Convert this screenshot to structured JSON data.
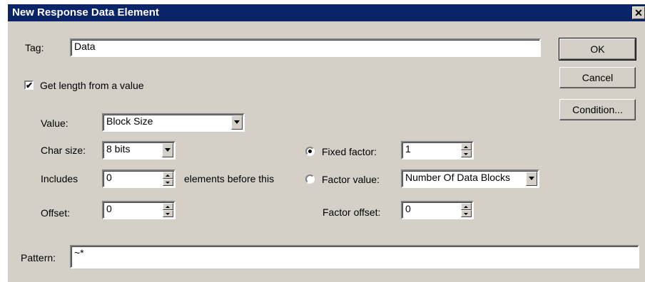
{
  "window": {
    "title": "New Response Data Element",
    "close": "✕"
  },
  "tag": {
    "label": "Tag:",
    "value": "Data"
  },
  "buttons": {
    "ok": "OK",
    "cancel": "Cancel",
    "condition": "Condition..."
  },
  "get_length": {
    "label": "Get length from a value",
    "checked": true,
    "check_glyph": "✔"
  },
  "value": {
    "label": "Value:",
    "selected": "Block Size"
  },
  "char_size": {
    "label": "Char size:",
    "selected": "8 bits"
  },
  "includes": {
    "label": "Includes",
    "value": "0",
    "suffix": "elements before this"
  },
  "offset": {
    "label": "Offset:",
    "value": "0"
  },
  "fixed_factor": {
    "label": "Fixed factor:",
    "value": "1",
    "selected": true
  },
  "factor_value": {
    "label": "Factor value:",
    "selected_option": "Number Of Data Blocks",
    "selected": false
  },
  "factor_offset": {
    "label": "Factor offset:",
    "value": "0"
  },
  "pattern": {
    "label": "Pattern:",
    "value": "~*"
  }
}
